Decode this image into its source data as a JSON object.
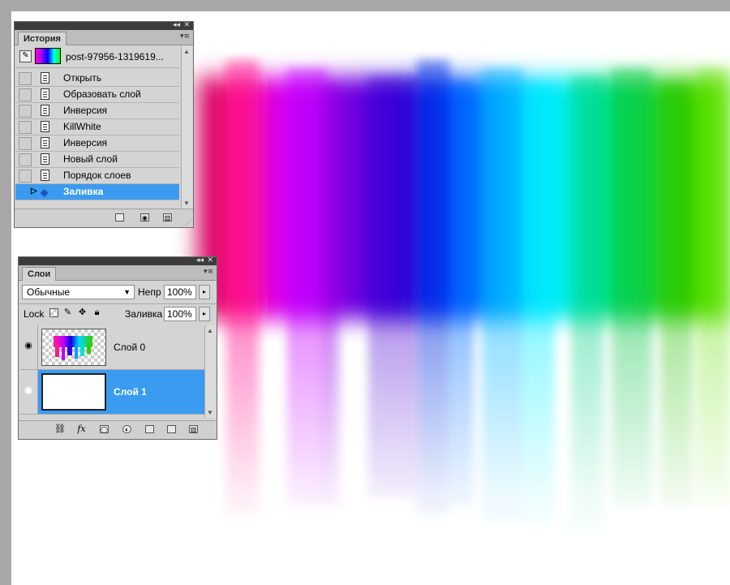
{
  "history_panel": {
    "tab_label": "История",
    "snapshot_name": "post-97956-1319619...",
    "items": [
      {
        "label": "Открыть",
        "selected": false
      },
      {
        "label": "Образовать слой",
        "selected": false
      },
      {
        "label": "Инверсия",
        "selected": false
      },
      {
        "label": "KillWhite",
        "selected": false
      },
      {
        "label": "Инверсия",
        "selected": false
      },
      {
        "label": "Новый слой",
        "selected": false
      },
      {
        "label": "Порядок слоев",
        "selected": false
      },
      {
        "label": "Заливка",
        "selected": true
      }
    ]
  },
  "layers_panel": {
    "tab_label": "Слои",
    "blend_mode": "Обычные",
    "opacity_label": "Непр",
    "opacity_value": "100%",
    "lock_label": "Lock",
    "fill_label": "Заливка",
    "fill_value": "100%",
    "layers": [
      {
        "name": "Слой 0",
        "selected": false
      },
      {
        "name": "Слой 1",
        "selected": true
      }
    ]
  },
  "colors": {
    "selection": "#3a9bf0",
    "panel_bg": "#d4d4d4",
    "workspace": "#a8a8a8"
  }
}
